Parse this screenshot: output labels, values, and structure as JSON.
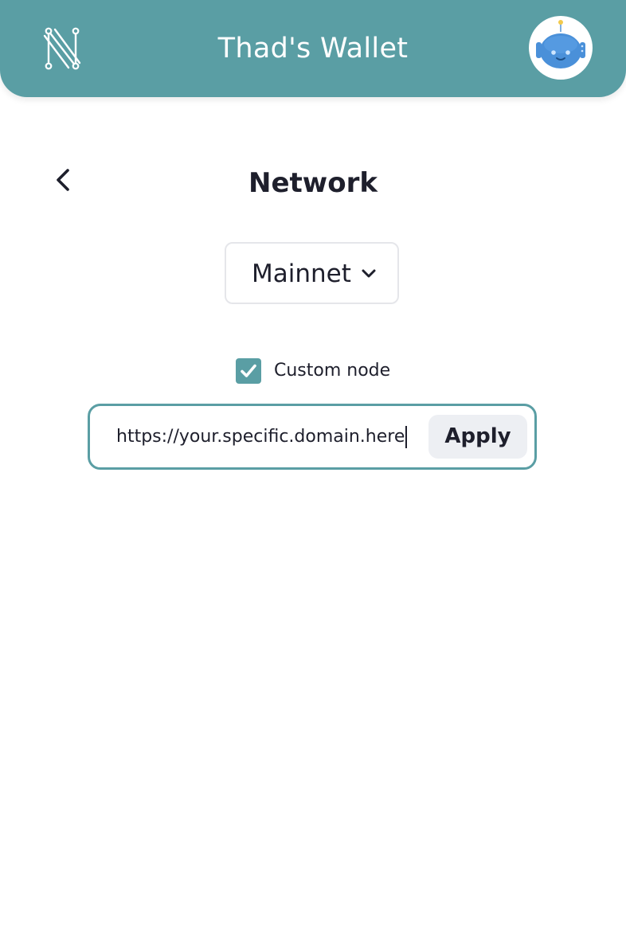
{
  "header": {
    "logo_icon": "nervos-logo-icon",
    "title": "Thad's Wallet",
    "avatar_icon": "robot-avatar-icon",
    "background_color": "#5a9ea4"
  },
  "page": {
    "back_icon": "chevron-left-icon",
    "title": "Network"
  },
  "network_select": {
    "selected": "Mainnet",
    "icon": "chevron-down-icon"
  },
  "custom_node": {
    "checked": true,
    "label": "Custom node",
    "input_value": "https://your.specific.domain.here",
    "apply_label": "Apply",
    "accent_color": "#5a9ea4"
  }
}
